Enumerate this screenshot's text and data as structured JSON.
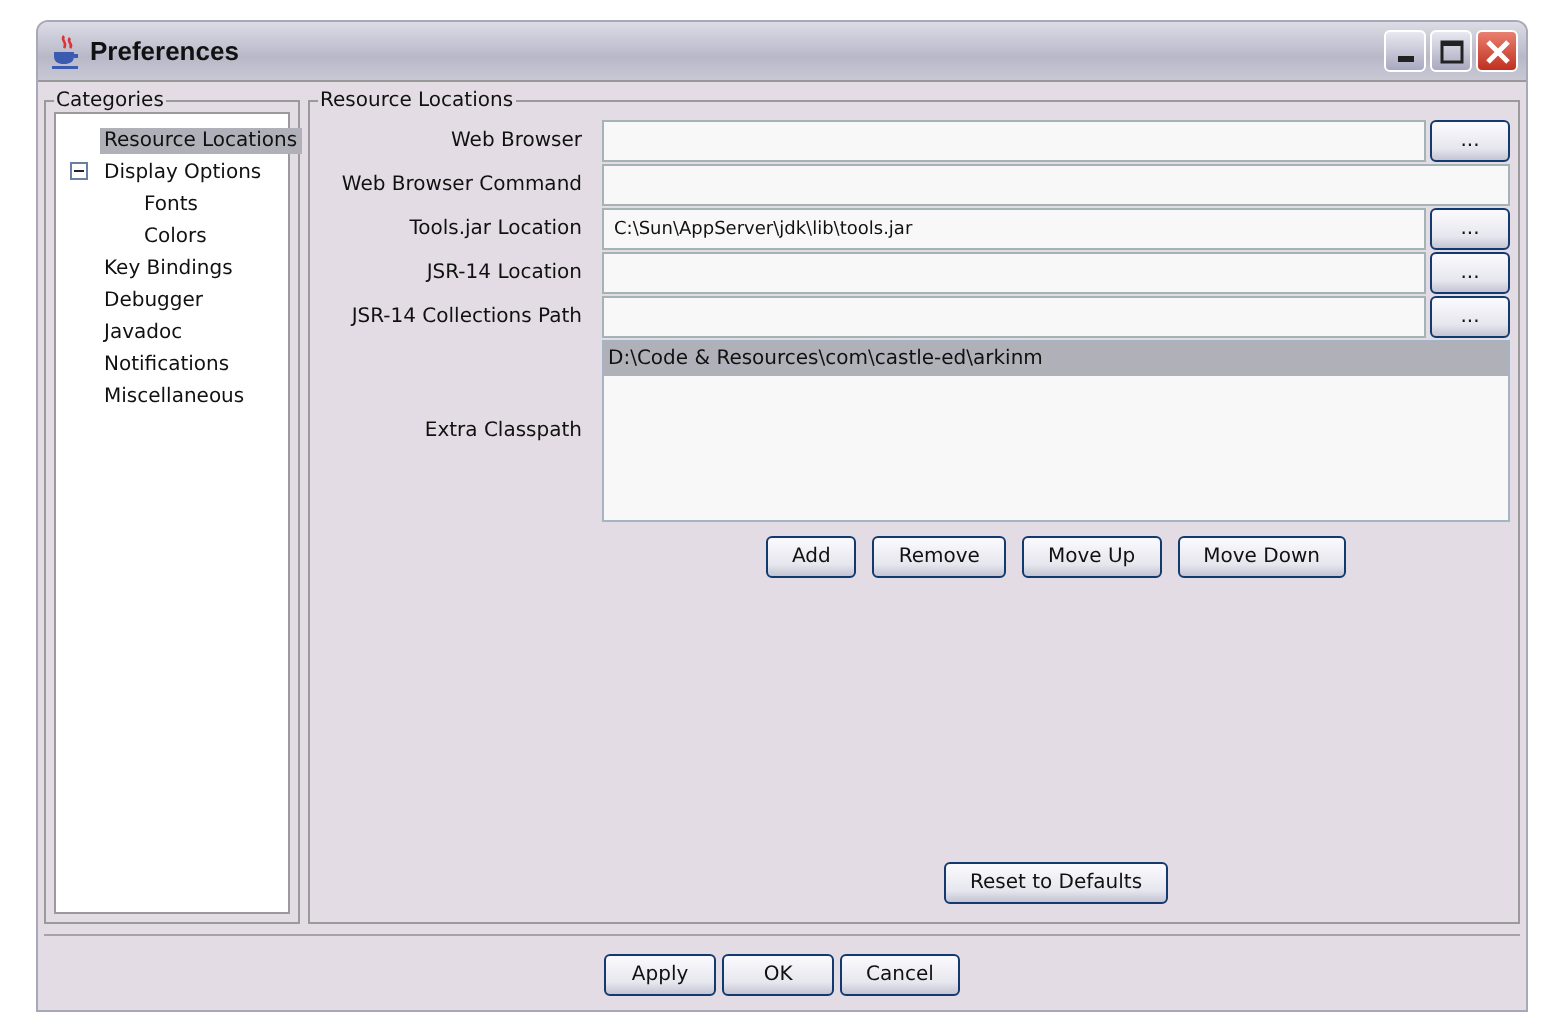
{
  "window": {
    "title": "Preferences"
  },
  "categories": {
    "title": "Categories",
    "items": [
      {
        "label": "Resource Locations",
        "selected": true
      },
      {
        "label": "Display Options",
        "selected": false,
        "expanded": true,
        "children": [
          {
            "label": "Fonts",
            "selected": false
          },
          {
            "label": "Colors",
            "selected": false
          }
        ]
      },
      {
        "label": "Key Bindings",
        "selected": false
      },
      {
        "label": "Debugger",
        "selected": false
      },
      {
        "label": "Javadoc",
        "selected": false
      },
      {
        "label": "Notifications",
        "selected": false
      },
      {
        "label": "Miscellaneous",
        "selected": false
      }
    ]
  },
  "panel": {
    "title": "Resource Locations",
    "fields": [
      {
        "label": "Web Browser",
        "browse": "..."
      },
      {
        "label": "Web Browser Command"
      },
      {
        "label": "Tools.jar Location",
        "value": "C:\\Sun\\AppServer\\jdk\\lib\\tools.jar",
        "browse": "..."
      },
      {
        "label": "JSR-14 Location",
        "browse": "..."
      },
      {
        "label": "JSR-14 Collections Path",
        "browse": "..."
      }
    ],
    "classpath": {
      "label": "Extra Classpath",
      "items": [
        {
          "text": "D:\\Code & Resources\\com\\castle-ed\\arkinm",
          "selected": true
        }
      ],
      "buttons": [
        "Add",
        "Remove",
        "Move Up",
        "Move Down"
      ]
    },
    "reset_button": "Reset to Defaults"
  },
  "buttons": [
    "Apply",
    "OK",
    "Cancel"
  ]
}
